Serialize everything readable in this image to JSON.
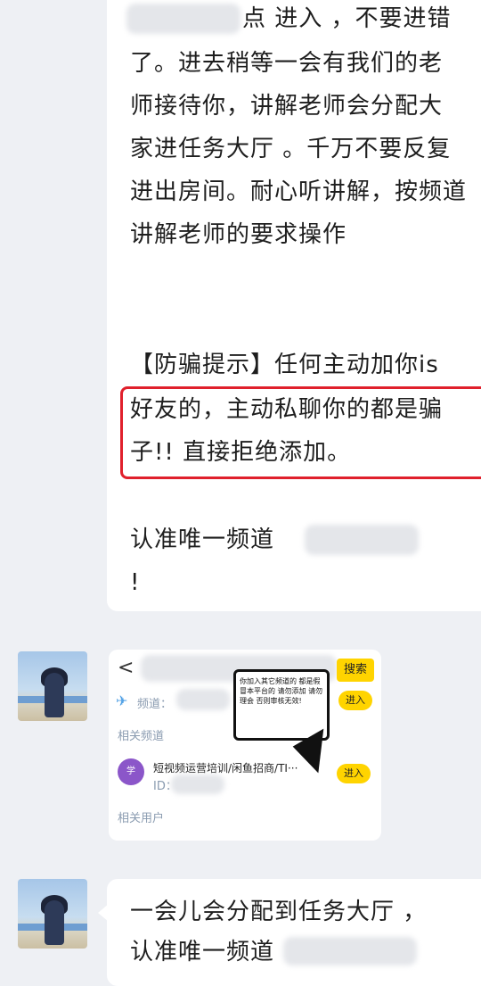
{
  "message1": {
    "lines": [
      "点 进入 ，不要进错",
      "了。进去稍等一会有我们的老",
      "师接待你，讲解老师会分配大",
      "家进任务大厅 。千万不要反复",
      "进出房间。耐心听讲解，按频道",
      "讲解老师的要求操作",
      "【防骗提示】任何主动加你is",
      "好友的，主动私聊你的都是骗",
      "子!! 直接拒绝添加。",
      "认准唯一频道",
      "!"
    ]
  },
  "screenshot": {
    "back": "<",
    "search_label": "搜索",
    "channel_label": "频道：",
    "enter_label_1": "进入",
    "related_channels": "相关频道",
    "item_title": "短视频运营培训/闲鱼招商/TI···",
    "item_id": "ID：",
    "enter_label_2": "进入",
    "related_users": "相关用户",
    "callout_text": "你加入其它频道的 都是假冒本平台的 请勿添加 请勿理会 否则审核无效!",
    "app_avatar_text": "学"
  },
  "message2": {
    "line1": "一会儿会分配到任务大厅 ，",
    "line2": "认准唯一频道"
  },
  "colors": {
    "background": "#eef0f4",
    "bubble": "#ffffff",
    "warning_border": "#e0202c",
    "button_yellow": "#ffd400"
  }
}
